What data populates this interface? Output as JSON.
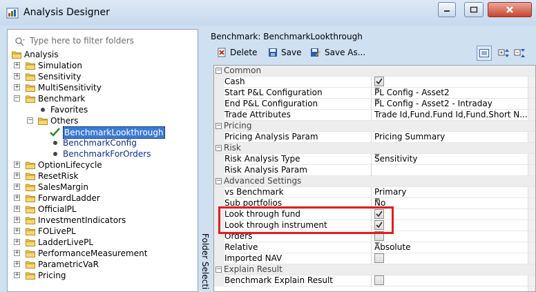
{
  "window": {
    "title": "Analysis Designer"
  },
  "colors": {
    "accent": "#3b7bd6",
    "highlight": "#e21d1d",
    "category_bg": "#ededed"
  },
  "left": {
    "filter_placeholder": "Type here to filter folders",
    "vertical_tab": "Folder Selecti"
  },
  "tree": [
    {
      "label": "Analysis",
      "level": 0,
      "icon": "folder",
      "expander": ""
    },
    {
      "label": "Simulation",
      "level": 1,
      "icon": "folder",
      "expander": "+"
    },
    {
      "label": "Sensitivity",
      "level": 1,
      "icon": "folder",
      "expander": "+"
    },
    {
      "label": "MultiSensitivity",
      "level": 1,
      "icon": "folder",
      "expander": "+"
    },
    {
      "label": "Benchmark",
      "level": 1,
      "icon": "folder",
      "expander": "-"
    },
    {
      "label": "Favorites",
      "level": 2,
      "icon": "dot",
      "expander": ""
    },
    {
      "label": "Others",
      "level": 2,
      "icon": "folder",
      "expander": "-"
    },
    {
      "label": "BenchmarkLookthrough",
      "level": 3,
      "icon": "check",
      "expander": "",
      "selected": true
    },
    {
      "label": "BenchmarkConfig",
      "level": 3,
      "icon": "dot",
      "expander": ""
    },
    {
      "label": "BenchmarkForOrders",
      "level": 3,
      "icon": "dot",
      "expander": ""
    },
    {
      "label": "OptionLifecycle",
      "level": 1,
      "icon": "folder",
      "expander": "+"
    },
    {
      "label": "ResetRisk",
      "level": 1,
      "icon": "folder",
      "expander": "+"
    },
    {
      "label": "SalesMargin",
      "level": 1,
      "icon": "folder",
      "expander": "+"
    },
    {
      "label": "ForwardLadder",
      "level": 1,
      "icon": "folder",
      "expander": "+"
    },
    {
      "label": "OfficialPL",
      "level": 1,
      "icon": "folder",
      "expander": "+"
    },
    {
      "label": "InvestmentIndicators",
      "level": 1,
      "icon": "folder",
      "expander": "+"
    },
    {
      "label": "FOLivePL",
      "level": 1,
      "icon": "folder",
      "expander": "+"
    },
    {
      "label": "LadderLivePL",
      "level": 1,
      "icon": "folder",
      "expander": "+"
    },
    {
      "label": "PerformanceMeasurement",
      "level": 1,
      "icon": "folder",
      "expander": "+"
    },
    {
      "label": "ParametricVaR",
      "level": 1,
      "icon": "folder",
      "expander": "+"
    },
    {
      "label": "Pricing",
      "level": 1,
      "icon": "folder",
      "expander": "+"
    }
  ],
  "right": {
    "title": "Benchmark: BenchmarkLookthrough",
    "toolbar": {
      "delete": "Delete",
      "save": "Save",
      "save_as": "Save As..."
    }
  },
  "grid": [
    {
      "type": "category",
      "label": "Common"
    },
    {
      "type": "prop",
      "key": "Cash",
      "kind": "check",
      "checked": true
    },
    {
      "type": "prop",
      "key": "Start P&L Configuration",
      "kind": "dropdown",
      "value": "PL Config - Asset2"
    },
    {
      "type": "prop",
      "key": "End P&L Configuration",
      "kind": "dropdown",
      "value": "PL Config - Asset2 - Intraday"
    },
    {
      "type": "prop",
      "key": "Trade Attributes",
      "kind": "text",
      "value": "Trade Id,Fund.Fund Id,Fund.Short N..."
    },
    {
      "type": "category",
      "label": "Pricing"
    },
    {
      "type": "prop",
      "key": "Pricing Analysis Param",
      "kind": "text",
      "value": "Pricing Summary"
    },
    {
      "type": "category",
      "label": "Risk"
    },
    {
      "type": "prop",
      "key": "Risk Analysis Type",
      "kind": "dropdown",
      "value": "Sensitivity"
    },
    {
      "type": "prop",
      "key": "Risk Analysis Param",
      "kind": "text",
      "value": ""
    },
    {
      "type": "category",
      "label": "Advanced Settings"
    },
    {
      "type": "prop",
      "key": "vs Benchmark",
      "kind": "text",
      "value": "Primary"
    },
    {
      "type": "prop",
      "key": "Sub portfolios",
      "kind": "dropdown",
      "value": "No"
    },
    {
      "type": "prop",
      "key": "Look through fund",
      "kind": "check",
      "checked": true
    },
    {
      "type": "prop",
      "key": "Look through instrument",
      "kind": "check",
      "checked": true
    },
    {
      "type": "prop",
      "key": "Orders",
      "kind": "check",
      "checked": false
    },
    {
      "type": "prop",
      "key": "Relative",
      "kind": "dropdown",
      "value": "Absolute"
    },
    {
      "type": "prop",
      "key": "Imported NAV",
      "kind": "check",
      "checked": false
    },
    {
      "type": "category",
      "label": "Explain Result"
    },
    {
      "type": "prop",
      "key": "Benchmark Explain Result",
      "kind": "check",
      "checked": false
    }
  ]
}
